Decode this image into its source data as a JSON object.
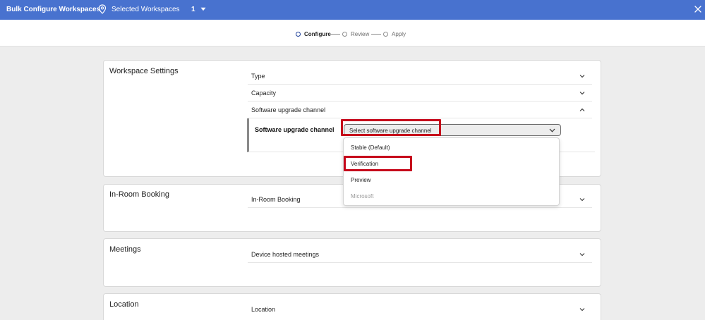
{
  "header": {
    "title": "Bulk Configure Workspaces",
    "selected_label": "Selected Workspaces",
    "selected_count": "1",
    "icons": {
      "location": "map-pin-icon",
      "caret": "caret-down-icon",
      "close": "close-icon"
    }
  },
  "stepper": {
    "steps": [
      {
        "label": "Configure",
        "active": true
      },
      {
        "label": "Review",
        "active": false
      },
      {
        "label": "Apply",
        "active": false
      }
    ]
  },
  "workspace_settings": {
    "title": "Workspace Settings",
    "rows": [
      {
        "label": "Type",
        "expanded": false
      },
      {
        "label": "Capacity",
        "expanded": false
      },
      {
        "label": "Software upgrade channel",
        "expanded": true
      }
    ],
    "upgrade": {
      "label": "Software upgrade channel",
      "placeholder": "Select software upgrade channel",
      "options": [
        {
          "label": "Stable (Default)",
          "disabled": false
        },
        {
          "label": "Verification",
          "disabled": false
        },
        {
          "label": "Preview",
          "disabled": false
        },
        {
          "label": "Microsoft",
          "disabled": true
        }
      ]
    }
  },
  "in_room_booking": {
    "title": "In-Room Booking",
    "rows": [
      {
        "label": "In-Room Booking"
      }
    ]
  },
  "meetings": {
    "title": "Meetings",
    "rows": [
      {
        "label": "Device hosted meetings"
      }
    ]
  },
  "location": {
    "title": "Location",
    "rows": [
      {
        "label": "Location"
      }
    ]
  },
  "colors": {
    "header_bg": "#4872cf",
    "highlight": "#c6081b",
    "active_step": "#1d3f9a"
  }
}
